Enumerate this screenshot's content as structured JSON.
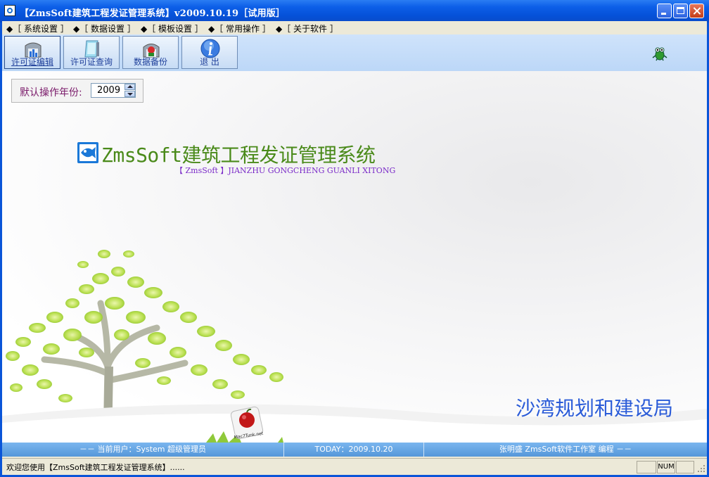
{
  "window": {
    "title": "【ZmsSoft建筑工程发证管理系统】v2009.10.19［试用版］",
    "controls": {
      "minimize": "minimize",
      "maximize": "maximize",
      "close": "close"
    }
  },
  "menu": {
    "items": [
      {
        "label": "◆［ 系统设置 ］"
      },
      {
        "label": "◆［ 数据设置 ］"
      },
      {
        "label": "◆［ 模板设置 ］"
      },
      {
        "label": "◆［ 常用操作 ］"
      },
      {
        "label": "◆［ 关于软件 ］"
      }
    ]
  },
  "toolbar": {
    "buttons": [
      {
        "label": "许可证编辑",
        "icon": "permit-edit-icon"
      },
      {
        "label": "许可证查询",
        "icon": "permit-query-icon"
      },
      {
        "label": "数据备份",
        "icon": "data-backup-icon"
      },
      {
        "label": "退    出",
        "icon": "info-icon"
      }
    ]
  },
  "main": {
    "year_label": "默认操作年份:",
    "year_value": "2009",
    "app_title": "ZmsSoft建筑工程发证管理系统",
    "app_subtitle": "【 ZmsSoft 】JIANZHU GONGCHENG  GUANLI XITONG",
    "org_name": "沙湾规划和建设局",
    "badge_text": "Mac7Tunk.net"
  },
  "infobar": {
    "user": "－－   当前用户：System     超级管理员",
    "today": "TODAY：2009.10.20",
    "author": "张明盛 ZmsSoft软件工作室 编程   －－"
  },
  "statusbar": {
    "message": "欢迎您使用【ZmsSoft建筑工程发证管理系统】......",
    "panes": [
      "",
      "NUM",
      ""
    ]
  },
  "colors": {
    "titlebar": "#0a55d8",
    "title_green": "#4a8a1a",
    "subtitle_purple": "#7a2ac8",
    "org_blue": "#2a5bd8",
    "infobar": "#6aa8e6"
  }
}
